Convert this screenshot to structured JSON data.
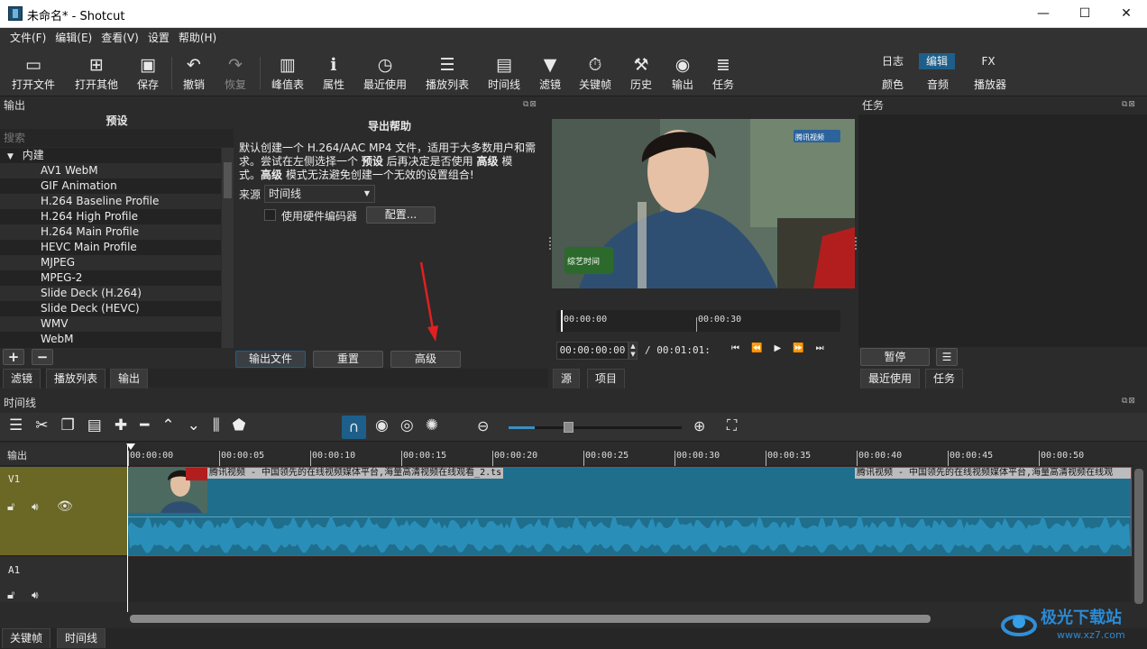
{
  "window": {
    "title": "未命名* - Shotcut",
    "minimize": "—",
    "maximize": "☐",
    "close": "✕"
  },
  "menu": [
    "文件(F)",
    "编辑(E)",
    "查看(V)",
    "设置",
    "帮助(H)"
  ],
  "toolbar": [
    {
      "label": "打开文件",
      "icon": "folder-icon"
    },
    {
      "label": "打开其他",
      "icon": "open-other-icon"
    },
    {
      "label": "保存",
      "icon": "save-icon"
    },
    {
      "label": "撤销",
      "icon": "undo-icon"
    },
    {
      "label": "恢复",
      "icon": "redo-icon"
    },
    {
      "label": "峰值表",
      "icon": "meter-icon"
    },
    {
      "label": "属性",
      "icon": "info-icon"
    },
    {
      "label": "最近使用",
      "icon": "clock-icon"
    },
    {
      "label": "播放列表",
      "icon": "list-icon"
    },
    {
      "label": "时间线",
      "icon": "timeline-icon"
    },
    {
      "label": "滤镜",
      "icon": "filter-icon"
    },
    {
      "label": "关键帧",
      "icon": "stopwatch-icon"
    },
    {
      "label": "历史",
      "icon": "history-icon"
    },
    {
      "label": "输出",
      "icon": "disc-icon"
    },
    {
      "label": "任务",
      "icon": "database-icon"
    }
  ],
  "layouts": {
    "row1": [
      "日志",
      "编辑",
      "FX"
    ],
    "row2": [
      "颜色",
      "音频",
      "播放器"
    ],
    "active": "编辑"
  },
  "export": {
    "panel_title": "输出",
    "presets_header": "预设",
    "search_placeholder": "搜索",
    "group": "内建",
    "presets": [
      "AV1 WebM",
      "GIF Animation",
      "H.264 Baseline Profile",
      "H.264 High Profile",
      "H.264 Main Profile",
      "HEVC Main Profile",
      "MJPEG",
      "MPEG-2",
      "Slide Deck (H.264)",
      "Slide Deck (HEVC)",
      "WMV",
      "WebM"
    ],
    "help_title": "导出帮助",
    "help_line1": "默认创建一个 H.264/AAC MP4 文件，适用于大多数用户和需",
    "help_line2a": "求。尝试在左侧选择一个 ",
    "help_bold1": "预设",
    "help_line2b": " 后再决定是否使用 ",
    "help_bold2": "高级",
    "help_line2c": " 模",
    "help_line3a": "式。",
    "help_bold3": "高级",
    "help_line3b": " 模式无法避免创建一个无效的设置组合!",
    "source_label": "来源",
    "source_value": "时间线",
    "hw_encoder": "使用硬件编码器",
    "configure": "配置...",
    "export_file": "输出文件",
    "reset": "重置",
    "advanced": "高级",
    "add": "+",
    "remove": "−"
  },
  "left_tabs": [
    "滤镜",
    "播放列表",
    "输出"
  ],
  "player": {
    "ruler_start": "00:00:00",
    "ruler_mid": "00:00:30",
    "position": "00:00:00:00",
    "duration": "/ 00:01:01:",
    "tabs": [
      "源",
      "项目"
    ],
    "video_caption": "综艺时间",
    "video_logo": "腾讯视频"
  },
  "jobs": {
    "title": "任务",
    "pause": "暂停",
    "menu": "☰",
    "tabs": [
      "最近使用",
      "任务"
    ]
  },
  "timeline": {
    "title": "时间线",
    "output_label": "输出",
    "ticks": [
      "00:00:00",
      "00:00:05",
      "00:00:10",
      "00:00:15",
      "00:00:20",
      "00:00:25",
      "00:00:30",
      "00:00:35",
      "00:00:40",
      "00:00:45",
      "00:00:50"
    ],
    "tracks": [
      {
        "name": "V1"
      },
      {
        "name": "A1"
      }
    ],
    "clip_name1": "腾讯视频 - 中国领先的在线视频媒体平台,海量高清视频在线观看_2.ts",
    "clip_name2": "腾讯视频 - 中国领先的在线视频媒体平台,海量高清视频在线观",
    "zoom_level": 0.15
  },
  "bottom_tabs": [
    "关键帧",
    "时间线"
  ],
  "watermark": {
    "text": "极光下载站",
    "url": "www.xz7.com"
  },
  "colors": {
    "accent": "#1d5f8a",
    "track_bg": "#6b6725",
    "clip": "#1f6e8c",
    "playhead": "#ffffff",
    "annotation": "#e02020"
  }
}
